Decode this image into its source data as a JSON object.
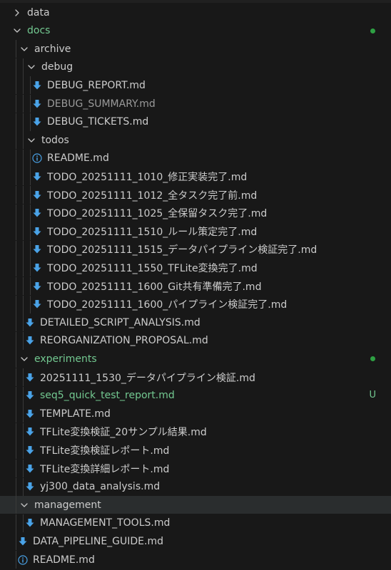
{
  "colors": {
    "background": "#181818",
    "text": "#cccccc",
    "git_untracked": "#73c991",
    "git_dot": "#2ea043",
    "markdown_icon": "#4aa3e8",
    "info_icon": "#4aa3e8",
    "selection": "#2a2d2e"
  },
  "tree": [
    {
      "label": "data",
      "kind": "folder",
      "expanded": false,
      "depth": 0
    },
    {
      "label": "docs",
      "kind": "folder",
      "expanded": true,
      "depth": 0,
      "status": "dot",
      "color": "green"
    },
    {
      "label": "archive",
      "kind": "folder",
      "expanded": true,
      "depth": 1
    },
    {
      "label": "debug",
      "kind": "folder",
      "expanded": true,
      "depth": 2
    },
    {
      "label": "DEBUG_REPORT.md",
      "kind": "markdown",
      "depth": 3
    },
    {
      "label": "DEBUG_SUMMARY.md",
      "kind": "markdown",
      "depth": 3,
      "color": "dim"
    },
    {
      "label": "DEBUG_TICKETS.md",
      "kind": "markdown",
      "depth": 3
    },
    {
      "label": "todos",
      "kind": "folder",
      "expanded": true,
      "depth": 2
    },
    {
      "label": "README.md",
      "kind": "info",
      "depth": 3
    },
    {
      "label": "TODO_20251111_1010_修正実装完了.md",
      "kind": "markdown",
      "depth": 3
    },
    {
      "label": "TODO_20251111_1012_全タスク完了前.md",
      "kind": "markdown",
      "depth": 3
    },
    {
      "label": "TODO_20251111_1025_全保留タスク完了.md",
      "kind": "markdown",
      "depth": 3
    },
    {
      "label": "TODO_20251111_1510_ルール策定完了.md",
      "kind": "markdown",
      "depth": 3
    },
    {
      "label": "TODO_20251111_1515_データパイプライン検証完了.md",
      "kind": "markdown",
      "depth": 3
    },
    {
      "label": "TODO_20251111_1550_TFLite変換完了.md",
      "kind": "markdown",
      "depth": 3
    },
    {
      "label": "TODO_20251111_1600_Git共有準備完了.md",
      "kind": "markdown",
      "depth": 3
    },
    {
      "label": "TODO_20251111_1600_パイプライン検証完了.md",
      "kind": "markdown",
      "depth": 3
    },
    {
      "label": "DETAILED_SCRIPT_ANALYSIS.md",
      "kind": "markdown",
      "depth": 2
    },
    {
      "label": "REORGANIZATION_PROPOSAL.md",
      "kind": "markdown",
      "depth": 2
    },
    {
      "label": "experiments",
      "kind": "folder",
      "expanded": true,
      "depth": 1,
      "status": "dot",
      "color": "green"
    },
    {
      "label": "20251111_1530_データパイプライン検証.md",
      "kind": "markdown",
      "depth": 2
    },
    {
      "label": "seq5_quick_test_report.md",
      "kind": "markdown",
      "depth": 2,
      "status": "U",
      "color": "green"
    },
    {
      "label": "TEMPLATE.md",
      "kind": "markdown",
      "depth": 2
    },
    {
      "label": "TFLite変換検証_20サンプル結果.md",
      "kind": "markdown",
      "depth": 2
    },
    {
      "label": "TFLite変換検証レポート.md",
      "kind": "markdown",
      "depth": 2
    },
    {
      "label": "TFLite変換詳細レポート.md",
      "kind": "markdown",
      "depth": 2
    },
    {
      "label": "yj300_data_analysis.md",
      "kind": "markdown",
      "depth": 2
    },
    {
      "label": "management",
      "kind": "folder",
      "expanded": true,
      "depth": 1,
      "selected": true
    },
    {
      "label": "MANAGEMENT_TOOLS.md",
      "kind": "markdown",
      "depth": 2
    },
    {
      "label": "DATA_PIPELINE_GUIDE.md",
      "kind": "markdown",
      "depth": 1
    },
    {
      "label": "README.md",
      "kind": "info",
      "depth": 1
    }
  ]
}
